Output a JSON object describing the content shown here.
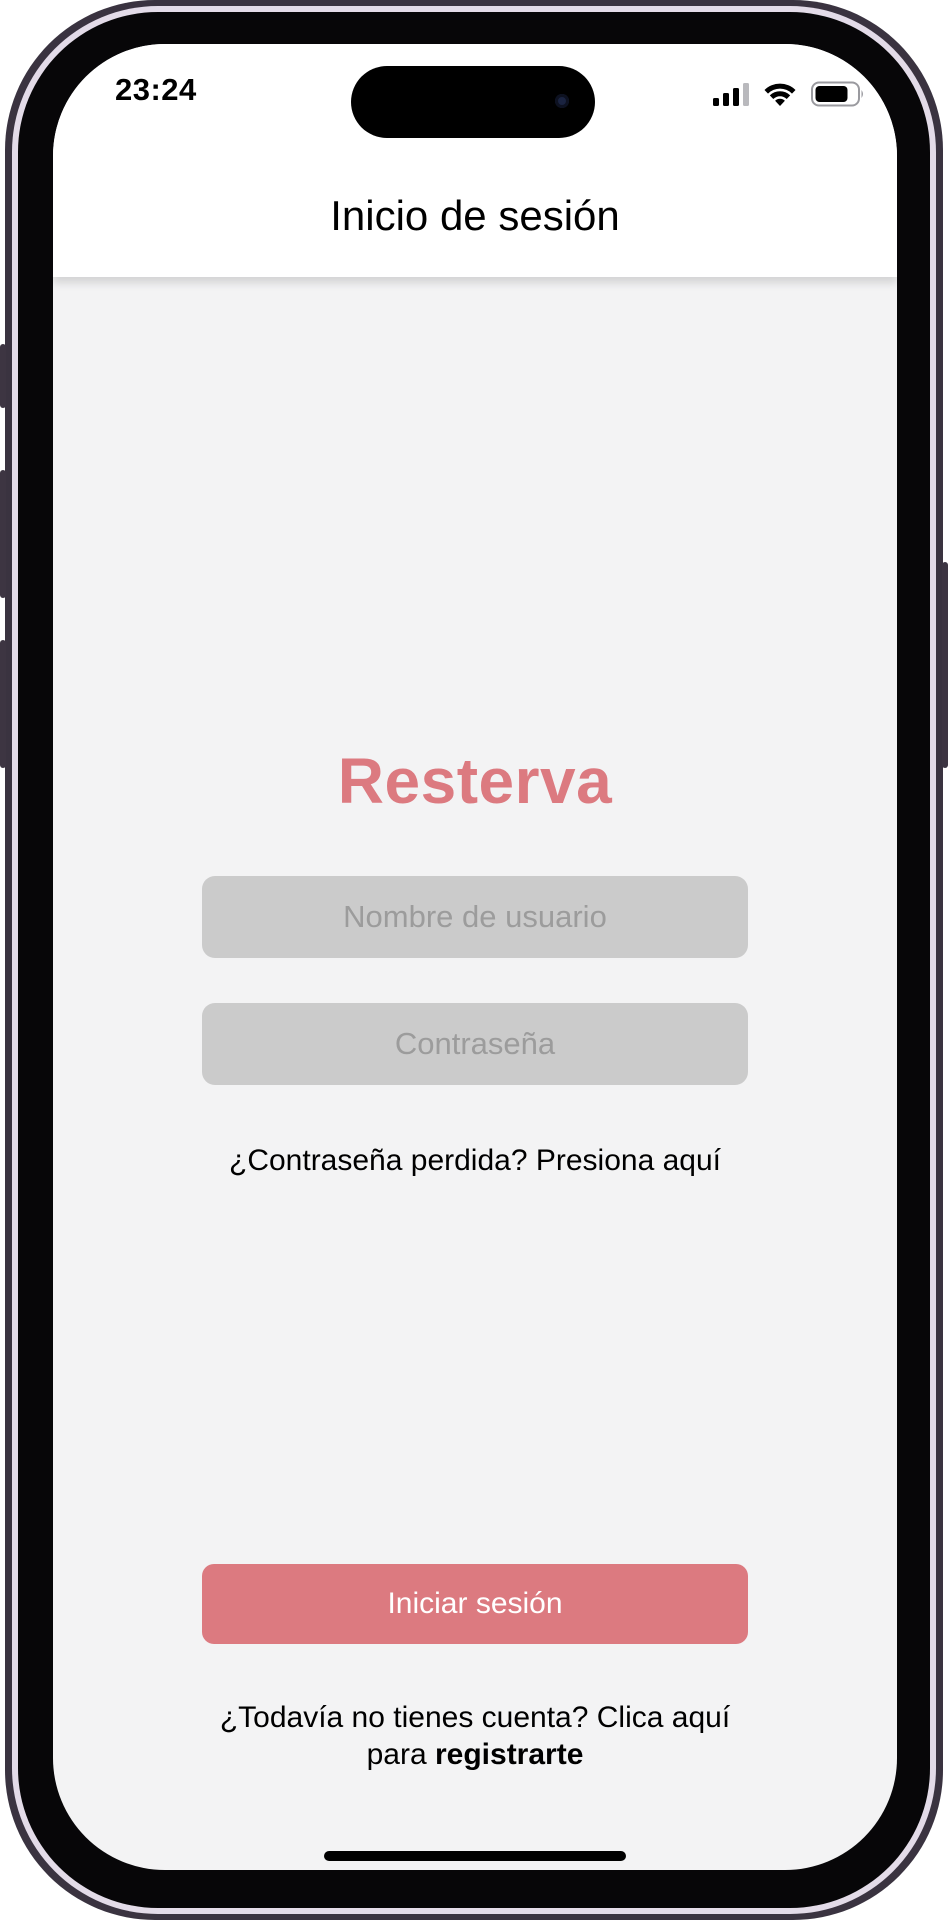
{
  "status_bar": {
    "time": "23:24",
    "icons": [
      "cellular-signal-icon",
      "wifi-icon",
      "battery-icon"
    ]
  },
  "header": {
    "title": "Inicio de sesión"
  },
  "brand": {
    "name": "Resterva",
    "color": "#dc7a80"
  },
  "form": {
    "username_placeholder": "Nombre de usuario",
    "username_value": "",
    "password_placeholder": "Contraseña",
    "password_value": "",
    "forgot_text": "¿Contraseña perdida? Presiona aquí"
  },
  "actions": {
    "login_label": "Iniciar sesión",
    "login_color": "#dc7a80",
    "signup_line1": "¿Todavía no tienes cuenta? Clica aquí",
    "signup_prefix": "para",
    "signup_bold": "registrarte"
  },
  "colors": {
    "background": "#f3f3f4",
    "field_background": "#cbcbcb",
    "header_background": "#ffffff"
  }
}
